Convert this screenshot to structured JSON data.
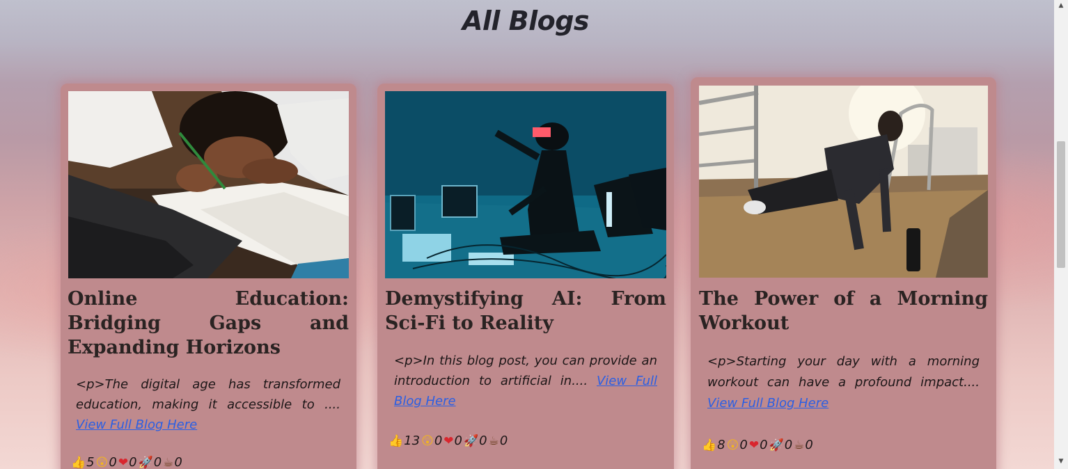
{
  "page": {
    "title": "All Blogs"
  },
  "colors": {
    "card_background": "#bf8a8d",
    "link": "#2b5fe3",
    "title_text": "#2a2322"
  },
  "blogs": [
    {
      "title": "Online Education: Bridging Gaps and Expanding Horizons",
      "excerpt": "<p>The digital age has transformed education, making it accessible to ....",
      "link_label": "View Full Blog Here",
      "image_icon": "student-writing-image",
      "reactions": {
        "like": "5",
        "wow": "0",
        "love": "0",
        "rocket": "0",
        "coffee": "0"
      }
    },
    {
      "title": "Demystifying AI: From Sci-Fi to Reality",
      "excerpt": "<p>In this blog post, you can provide an introduction to artificial in....",
      "link_label": "View Full Blog Here",
      "image_icon": "vr-headset-image",
      "reactions": {
        "like": "13",
        "wow": "0",
        "love": "0",
        "rocket": "0",
        "coffee": "0"
      }
    },
    {
      "title": "The Power of a Morning Workout",
      "excerpt": "<p>Starting your day with a morning workout can have a profound impact....",
      "link_label": "View Full Blog Here",
      "image_icon": "pushup-workout-image",
      "reactions": {
        "like": "8",
        "wow": "0",
        "love": "0",
        "rocket": "0",
        "coffee": "0"
      }
    }
  ],
  "reaction_icons": {
    "like": "thumbs-up-icon",
    "wow": "wow-face-icon",
    "love": "heart-icon",
    "rocket": "rocket-icon",
    "coffee": "coffee-icon"
  }
}
